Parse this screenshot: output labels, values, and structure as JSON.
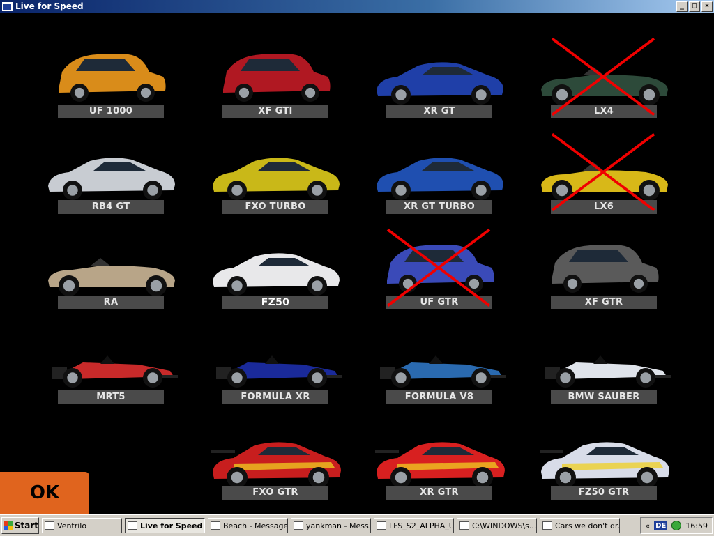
{
  "window": {
    "title": "Live for Speed",
    "controls": {
      "minimize": "_",
      "maximize": "□",
      "close": "×"
    }
  },
  "cars": [
    {
      "name": "UF 1000",
      "color": "#d98c1a",
      "type": "hatch",
      "excluded": false
    },
    {
      "name": "XF GTI",
      "color": "#b01822",
      "type": "hatch",
      "excluded": false
    },
    {
      "name": "XR GT",
      "color": "#1f3fa8",
      "type": "coupe",
      "excluded": false
    },
    {
      "name": "LX4",
      "color": "#2d4a3a",
      "type": "roadster",
      "excluded": true
    },
    {
      "name": "RB4 GT",
      "color": "#c8ccd2",
      "type": "coupe",
      "excluded": false
    },
    {
      "name": "FXO TURBO",
      "color": "#c9b818",
      "type": "coupe",
      "excluded": false
    },
    {
      "name": "XR GT TURBO",
      "color": "#1f4fb0",
      "type": "coupe",
      "excluded": false
    },
    {
      "name": "LX6",
      "color": "#d8b818",
      "type": "roadster",
      "excluded": true
    },
    {
      "name": "RA",
      "color": "#b8a588",
      "type": "roadster",
      "excluded": false
    },
    {
      "name": "FZ50",
      "color": "#e8e8ea",
      "type": "coupe",
      "excluded": false,
      "selected": true
    },
    {
      "name": "UF GTR",
      "color": "#3a4ab8",
      "type": "hatch",
      "excluded": true
    },
    {
      "name": "XF GTR",
      "color": "#5a5a5a",
      "type": "hatch",
      "excluded": false
    },
    {
      "name": "MRT5",
      "color": "#c82a2a",
      "type": "formula",
      "excluded": false
    },
    {
      "name": "FORMULA XR",
      "color": "#1a2a9a",
      "type": "formula",
      "excluded": false
    },
    {
      "name": "FORMULA V8",
      "color": "#2a6ab0",
      "type": "formula",
      "excluded": false
    },
    {
      "name": "BMW SAUBER",
      "color": "#dfe3ea",
      "type": "formula",
      "excluded": false
    },
    {
      "name": "FXO GTR",
      "color": "#c81e1e",
      "type": "gtr",
      "excluded": false
    },
    {
      "name": "XR GTR",
      "color": "#d82020",
      "type": "gtr",
      "excluded": false
    },
    {
      "name": "FZ50 GTR",
      "color": "#d8dce8",
      "type": "gtr",
      "excluded": false
    }
  ],
  "ok_button": {
    "label": "OK"
  },
  "taskbar": {
    "start_label": "Start",
    "tasks": [
      {
        "label": "Ventrilo",
        "active": false
      },
      {
        "label": "Live for Speed",
        "active": true
      },
      {
        "label": "Beach - Message",
        "active": false
      },
      {
        "label": "yankman - Mess...",
        "active": false
      },
      {
        "label": "LFS_S2_ALPHA_U",
        "active": false
      },
      {
        "label": "C:\\WINDOWS\\s...",
        "active": false
      },
      {
        "label": "Cars we don't dr...",
        "active": false
      }
    ],
    "language": "DE",
    "clock": "16:59",
    "tray_chevron": "«"
  }
}
